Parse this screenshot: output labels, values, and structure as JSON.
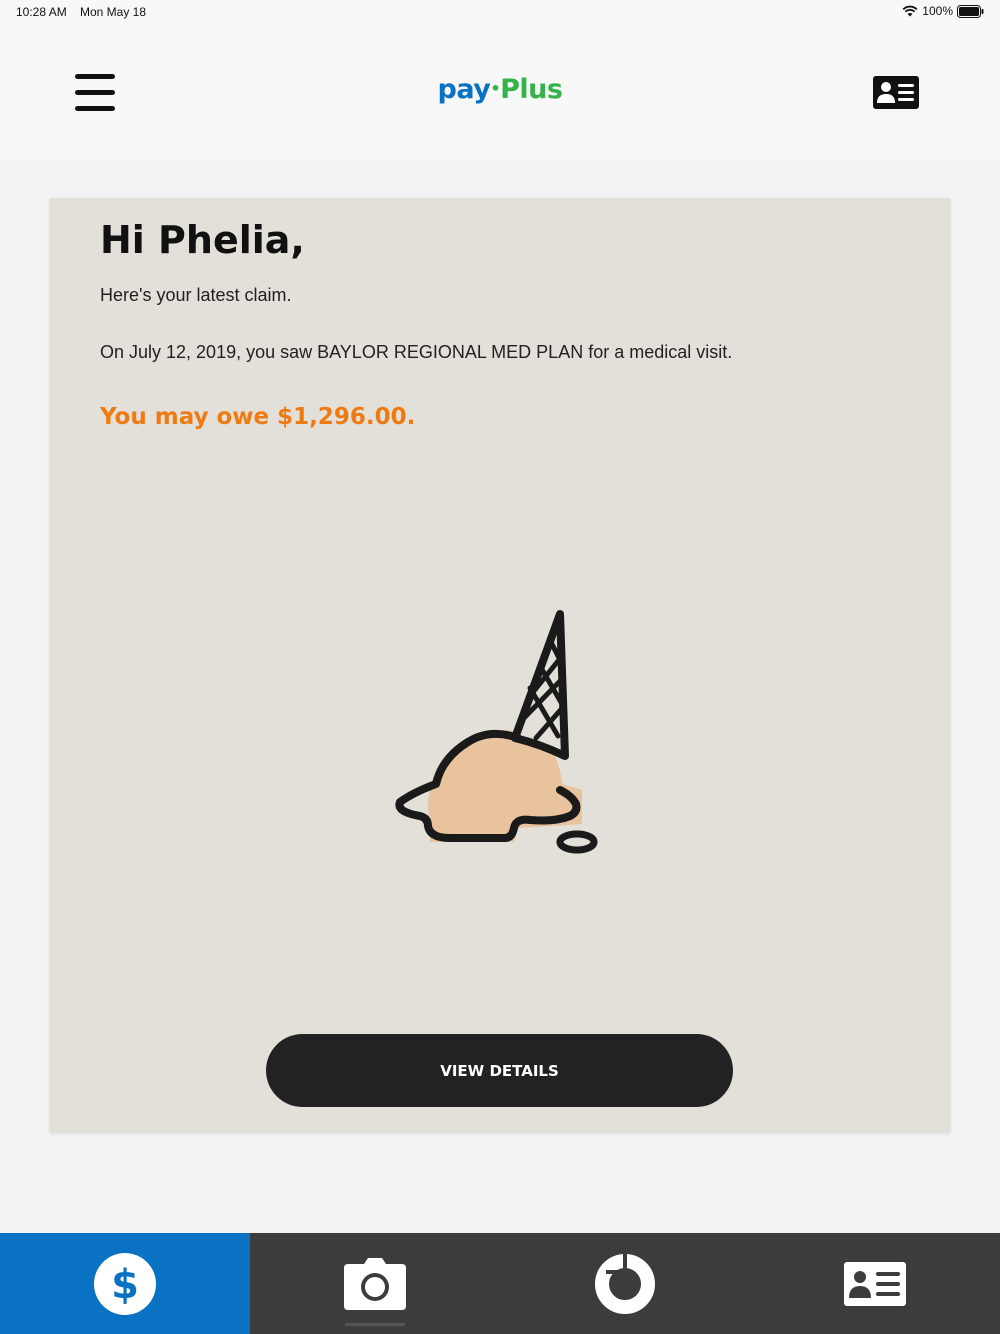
{
  "status_bar": {
    "time": "10:28 AM",
    "date": "Mon May 18",
    "battery": "100%"
  },
  "header": {
    "logo": {
      "part1": "pay",
      "part2": "Plus"
    },
    "menu_icon": "hamburger-menu-icon",
    "card_icon": "id-card-icon"
  },
  "claim_card": {
    "greeting": "Hi Phelia,",
    "subtitle": "Here's your latest claim.",
    "claim_text": "On July 12, 2019, you saw BAYLOR REGIONAL MED PLAN for a medical visit.",
    "owe_text": "You may owe $1,296.00.",
    "illustration": "dropped-ice-cream-cone",
    "button_label": "VIEW DETAILS"
  },
  "tab_bar": {
    "tabs": [
      {
        "icon": "dollar-icon",
        "active": true
      },
      {
        "icon": "camera-icon",
        "active": false
      },
      {
        "icon": "progress-ring-icon",
        "active": false
      },
      {
        "icon": "id-card-icon",
        "active": false
      }
    ]
  },
  "colors": {
    "brand_blue": "#0a72c2",
    "brand_green": "#35b34a",
    "owe_orange": "#f07a12",
    "card_bg": "#e3dfd9",
    "tab_bar_bg": "#3c3c3c",
    "button_bg": "#222222"
  }
}
